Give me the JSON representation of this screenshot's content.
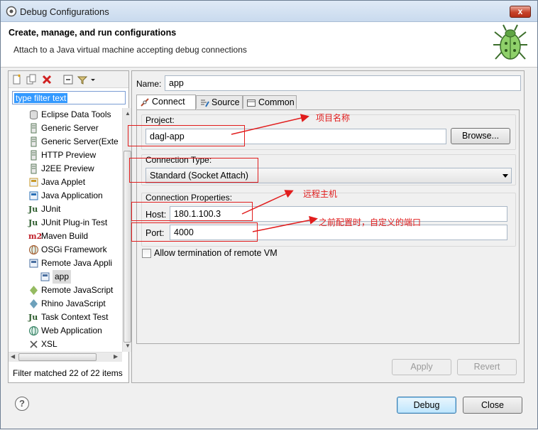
{
  "window": {
    "title": "Debug Configurations",
    "close_glyph": "x"
  },
  "banner": {
    "title": "Create, manage, and run configurations",
    "subtitle": "Attach to a Java virtual machine accepting debug connections",
    "icon": "bug-icon"
  },
  "left": {
    "filter_placeholder": "type filter text",
    "items": [
      {
        "label": "Eclipse Data Tools",
        "icon": "data-tools-icon"
      },
      {
        "label": "Generic Server",
        "icon": "server-icon"
      },
      {
        "label": "Generic Server(Exte",
        "icon": "server-icon"
      },
      {
        "label": "HTTP Preview",
        "icon": "server-icon"
      },
      {
        "label": "J2EE Preview",
        "icon": "server-icon"
      },
      {
        "label": "Java Applet",
        "icon": "java-applet-icon"
      },
      {
        "label": "Java Application",
        "icon": "java-app-icon"
      },
      {
        "label": "JUnit",
        "icon": "junit-icon",
        "glyph": "Ju"
      },
      {
        "label": "JUnit Plug-in Test",
        "icon": "junit-plugin-icon",
        "glyph": "Ju"
      },
      {
        "label": "Maven Build",
        "icon": "maven-icon",
        "glyph": "m2"
      },
      {
        "label": "OSGi Framework",
        "icon": "osgi-icon"
      },
      {
        "label": "Remote Java Appli",
        "icon": "remote-java-icon"
      },
      {
        "label": "app",
        "icon": "remote-config-icon"
      },
      {
        "label": "Remote JavaScript",
        "icon": "remote-js-icon"
      },
      {
        "label": "Rhino JavaScript",
        "icon": "rhino-icon"
      },
      {
        "label": "Task Context Test",
        "icon": "task-test-icon",
        "glyph": "Ju"
      },
      {
        "label": "Web Application",
        "icon": "web-app-icon"
      },
      {
        "label": "XSL",
        "icon": "xsl-icon"
      }
    ],
    "filter_status": "Filter matched 22 of 22 items"
  },
  "right": {
    "name_label": "Name:",
    "name_value": "app",
    "tabs": [
      {
        "label": "Connect",
        "icon": "connect-icon"
      },
      {
        "label": "Source",
        "icon": "source-icon"
      },
      {
        "label": "Common",
        "icon": "common-icon"
      }
    ],
    "project_label": "Project:",
    "project_value": "dagl-app",
    "browse_label": "Browse...",
    "connection_type_label": "Connection Type:",
    "connection_type_value": "Standard (Socket Attach)",
    "connection_props_label": "Connection Properties:",
    "host_label": "Host:",
    "host_value": "180.1.100.3",
    "port_label": "Port:",
    "port_value": "4000",
    "allow_termination_label": "Allow termination of remote VM",
    "apply_label": "Apply",
    "revert_label": "Revert"
  },
  "annotations": {
    "project_note": "项目名称",
    "host_note": "远程主机",
    "port_note": "之前配置时，自定义的端口"
  },
  "footer": {
    "help_glyph": "?",
    "debug_label": "Debug",
    "close_label": "Close"
  },
  "colors": {
    "annotation": "#e11d1d",
    "selection": "#3399ff"
  }
}
